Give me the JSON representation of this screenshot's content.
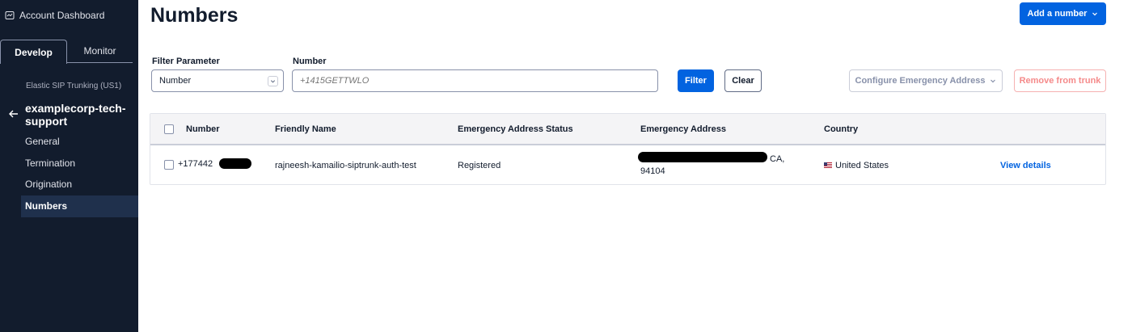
{
  "sidebar": {
    "account_label": "Account Dashboard",
    "tabs": [
      {
        "label": "Develop"
      },
      {
        "label": "Monitor"
      }
    ],
    "breadcrumb": "Elastic SIP Trunking (US1)",
    "project_name": "examplecorp-tech-support",
    "nav": [
      {
        "label": "General"
      },
      {
        "label": "Termination"
      },
      {
        "label": "Origination"
      },
      {
        "label": "Numbers"
      }
    ]
  },
  "page": {
    "title": "Numbers",
    "add_button": "Add a number"
  },
  "filters": {
    "parameter_label": "Filter Parameter",
    "parameter_value": "Number",
    "number_label": "Number",
    "number_placeholder": "+1415GETTWLO",
    "filter_button": "Filter",
    "clear_button": "Clear",
    "configure_button": "Configure Emergency Address",
    "remove_button": "Remove from trunk"
  },
  "table": {
    "columns": [
      "Number",
      "Friendly Name",
      "Emergency Address Status",
      "Emergency Address",
      "Country"
    ],
    "rows": [
      {
        "number": "+177442",
        "friendly_name": "rajneesh-kamailio-siptrunk-auth-test",
        "status": "Registered",
        "address_line1": "CA,",
        "address_line2": "94104",
        "country": "United States",
        "action": "View details"
      }
    ]
  },
  "colors": {
    "sidebar_bg": "#121c2d",
    "primary": "#0263e0",
    "destructive_disabled": "#f58a8a"
  }
}
